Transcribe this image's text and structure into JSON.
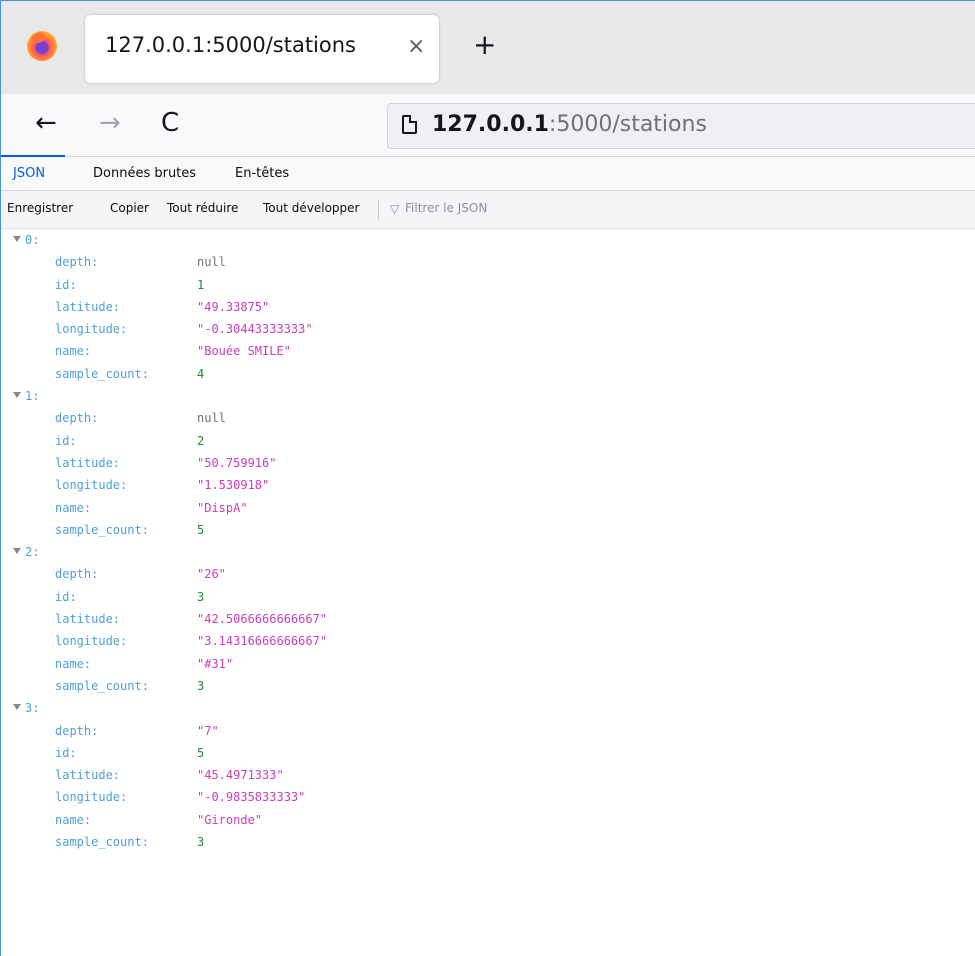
{
  "browser": {
    "tab": {
      "title": "127.0.0.1:5000/stations",
      "close": "×"
    },
    "new_tab": "+",
    "nav": {
      "back": "←",
      "forward": "→",
      "reload": "C"
    },
    "url": {
      "host": "127.0.0.1",
      "rest": ":5000/stations"
    }
  },
  "viewer": {
    "tabs": [
      "JSON",
      "Données brutes",
      "En-têtes"
    ],
    "active_tab": "JSON",
    "toolbar": {
      "save": "Enregistrer",
      "copy": "Copier",
      "collapse_all": "Tout réduire",
      "expand_all": "Tout développer",
      "filter_placeholder": "Filtrer le JSON"
    }
  },
  "colors": {
    "accent": "#0060df",
    "key": "#4fa0d8",
    "string": "#c73fbd",
    "number": "#1f8a2e",
    "null": "#737373"
  },
  "stations": [
    {
      "index": "0:",
      "fields": [
        {
          "key": "depth:",
          "value": "null",
          "type": "null"
        },
        {
          "key": "id:",
          "value": "1",
          "type": "number"
        },
        {
          "key": "latitude:",
          "value": "\"49.33875\"",
          "type": "string"
        },
        {
          "key": "longitude:",
          "value": "\"-0.30443333333\"",
          "type": "string"
        },
        {
          "key": "name:",
          "value": "\"Bouée SMILE\"",
          "type": "string"
        },
        {
          "key": "sample_count:",
          "value": "4",
          "type": "number"
        }
      ]
    },
    {
      "index": "1:",
      "fields": [
        {
          "key": "depth:",
          "value": "null",
          "type": "null"
        },
        {
          "key": "id:",
          "value": "2",
          "type": "number"
        },
        {
          "key": "latitude:",
          "value": "\"50.759916\"",
          "type": "string"
        },
        {
          "key": "longitude:",
          "value": "\"1.530918\"",
          "type": "string"
        },
        {
          "key": "name:",
          "value": "\"DispA\"",
          "type": "string"
        },
        {
          "key": "sample_count:",
          "value": "5",
          "type": "number"
        }
      ]
    },
    {
      "index": "2:",
      "fields": [
        {
          "key": "depth:",
          "value": "\"26\"",
          "type": "string"
        },
        {
          "key": "id:",
          "value": "3",
          "type": "number"
        },
        {
          "key": "latitude:",
          "value": "\"42.5066666666667\"",
          "type": "string"
        },
        {
          "key": "longitude:",
          "value": "\"3.14316666666667\"",
          "type": "string"
        },
        {
          "key": "name:",
          "value": "\"#31\"",
          "type": "string"
        },
        {
          "key": "sample_count:",
          "value": "3",
          "type": "number"
        }
      ]
    },
    {
      "index": "3:",
      "fields": [
        {
          "key": "depth:",
          "value": "\"7\"",
          "type": "string"
        },
        {
          "key": "id:",
          "value": "5",
          "type": "number"
        },
        {
          "key": "latitude:",
          "value": "\"45.4971333\"",
          "type": "string"
        },
        {
          "key": "longitude:",
          "value": "\"-0.9835833333\"",
          "type": "string"
        },
        {
          "key": "name:",
          "value": "\"Gironde\"",
          "type": "string"
        },
        {
          "key": "sample_count:",
          "value": "3",
          "type": "number"
        }
      ]
    }
  ]
}
